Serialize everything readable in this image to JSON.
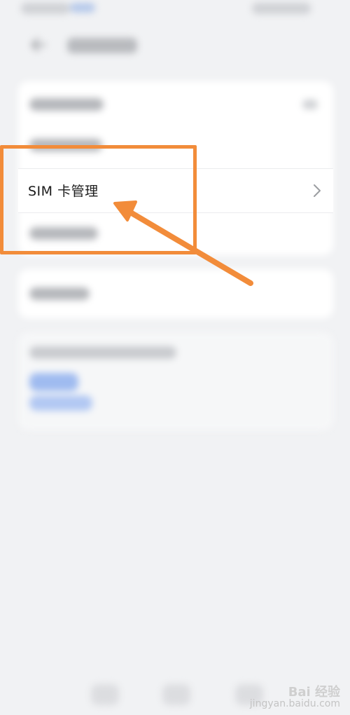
{
  "sim_row": {
    "label": "SIM 卡管理"
  },
  "watermark": {
    "logo_text": "Bai 经验",
    "url": "jingyan.baidu.com"
  },
  "colors": {
    "accent": "#f28c3a",
    "background": "#f1f2f4",
    "card": "#ffffff"
  },
  "icons": [
    "back-arrow-icon",
    "chevron-right-icon",
    "annotation-arrow-icon"
  ]
}
